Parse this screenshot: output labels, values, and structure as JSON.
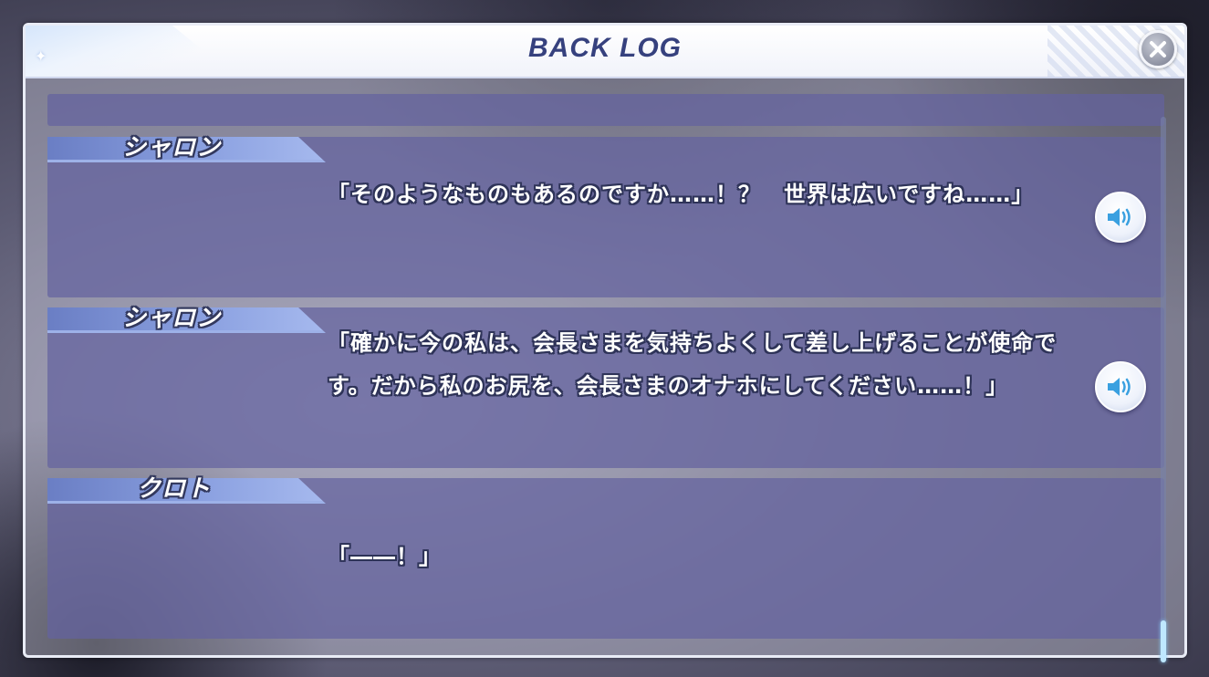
{
  "window": {
    "title": "BACK LOG",
    "close_icon": "close-icon"
  },
  "log": {
    "entries": [
      {
        "speaker": "",
        "text": "",
        "has_voice": false
      },
      {
        "speaker": "シャロン",
        "text": "「そのようなものもあるのですか……！？　世界は広いですね……」",
        "has_voice": true,
        "voice_icon": "speaker-icon"
      },
      {
        "speaker": "シャロン",
        "text": "「確かに今の私は、会長さまを気持ちよくして差し上げることが使命です。だから私のお尻を、会長さまのオナホにしてください……！」",
        "has_voice": true,
        "voice_icon": "speaker-icon"
      },
      {
        "speaker": "クロト",
        "text": "「――！」",
        "has_voice": false
      }
    ]
  },
  "colors": {
    "title": "#36417e",
    "entry_bg": "#64629f",
    "voice_icon": "#3aa0e0",
    "scroll_thumb": "#bfe8ff"
  }
}
